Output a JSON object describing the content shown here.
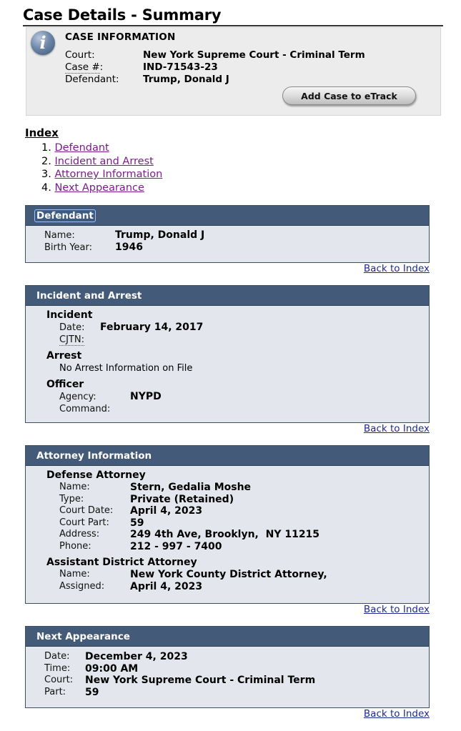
{
  "page": {
    "title": "Case Details - Summary"
  },
  "case_info": {
    "heading": "CASE INFORMATION",
    "icon": "info-icon",
    "rows": [
      {
        "label": "Court:",
        "value": "New York Supreme Court - Criminal Term"
      },
      {
        "label": "Case #",
        "label_suffix": ":",
        "value": "IND-71543-23"
      },
      {
        "label": "Defendant:",
        "value": "Trump, Donald J"
      }
    ],
    "add_button": "Add Case to eTrack"
  },
  "index": {
    "title": "Index",
    "items": [
      {
        "num": "1.",
        "label": "Defendant"
      },
      {
        "num": "2.",
        "label": "Incident and Arrest"
      },
      {
        "num": "3.",
        "label": "Attorney Information"
      },
      {
        "num": "4.",
        "label": "Next Appearance"
      }
    ]
  },
  "back_to_index": "Back to Index",
  "defendant": {
    "title": "Defendant",
    "rows": [
      {
        "label": "Name:",
        "value": "Trump, Donald J"
      },
      {
        "label": "Birth Year:",
        "value": "1946"
      }
    ]
  },
  "incident": {
    "title": "Incident and Arrest",
    "incident_heading": "Incident",
    "date_label": "Date:",
    "date_value": "February 14, 2017",
    "cjtn_label": "CJTN",
    "cjtn_suffix": ":",
    "arrest_heading": "Arrest",
    "arrest_text": "No Arrest Information on File",
    "officer_heading": "Officer",
    "agency_label": "Agency:",
    "agency_value": "NYPD",
    "command_label": "Command:"
  },
  "attorney": {
    "title": "Attorney Information",
    "defense_heading": "Defense Attorney",
    "defense_rows": [
      {
        "label": "Name:",
        "value": "Stern, Gedalia Moshe"
      },
      {
        "label": "Type:",
        "value": "Private (Retained)"
      },
      {
        "label": "Court Date:",
        "value": "April 4, 2023"
      },
      {
        "label": "Court Part:",
        "value": "59"
      },
      {
        "label": "Address:",
        "value": "249 4th Ave, Brooklyn,  NY 11215"
      },
      {
        "label": "Phone:",
        "value": "212 - 997 - 7400"
      }
    ],
    "ada_heading": "Assistant District Attorney",
    "ada_rows": [
      {
        "label": "Name:",
        "value": "New York County District Attorney,"
      },
      {
        "label": "Assigned:",
        "value": "April 4, 2023"
      }
    ]
  },
  "next_appearance": {
    "title": "Next Appearance",
    "rows": [
      {
        "label": "Date:",
        "value": "December 4, 2023"
      },
      {
        "label": "Time:",
        "value": "09:00 AM"
      },
      {
        "label": "Court:",
        "value": "New York Supreme Court - Criminal Term"
      },
      {
        "label": "Part:",
        "value": "59"
      }
    ]
  },
  "colors": {
    "section_header": "#435b78",
    "section_body": "#e3e7ed",
    "visited_link": "#7b1e8a",
    "link": "#1d2a8f",
    "case_box": "#ececec"
  }
}
